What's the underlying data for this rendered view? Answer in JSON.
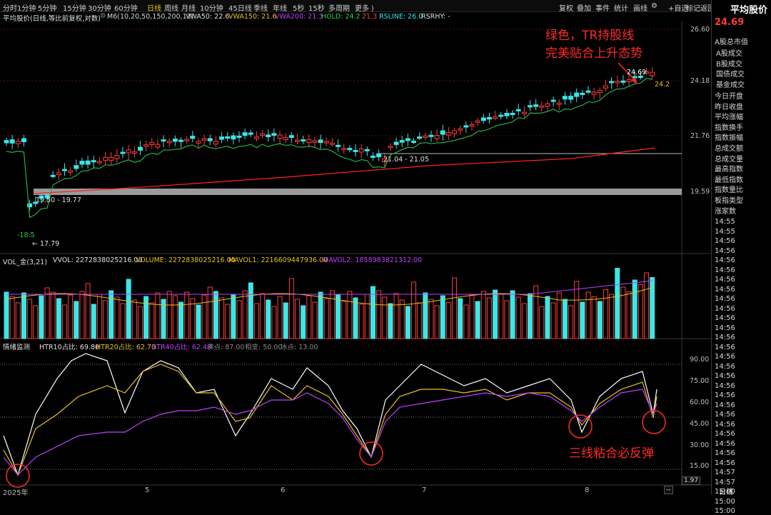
{
  "toolbar": {
    "periods": [
      "分时",
      "1分钟",
      "5分钟",
      "15分钟",
      "30分钟",
      "60分钟",
      "日线",
      "周线",
      "月线",
      "10分钟",
      "45日线",
      "季线",
      "年线",
      "5秒",
      "15秒",
      "多周期",
      "更多 ⟩"
    ],
    "active_period": "日线",
    "right_buttons": [
      "复权",
      "叠加",
      "事件",
      "统计",
      "画线",
      "⚙",
      "+自选",
      "标记",
      "返回"
    ]
  },
  "main_indicator": {
    "title": "平均股价(日线,等比前复权,对数)",
    "m6": "M6(10,20,50,150,200,13)",
    "vwa50": "VWA50: 22.6",
    "vwa150": "VWA150: 21.6",
    "vwa200": "VWA200: 21.3",
    "hold": "HOLD: 24.2",
    "hold_sub": "21.3",
    "rsline": "RSLINE: 26.0",
    "rsrhy": "RSRHY: -"
  },
  "main_axis": [
    "26.60",
    "24.18",
    "21.76",
    "19.59"
  ],
  "main_labels": {
    "hi_price": "24.69",
    "last_price": "24.2",
    "band_label": "21.04 - 21.05",
    "support_label": "19.50 - 19.77",
    "low_label": "-18.5",
    "min_label": "17.79"
  },
  "vol_indicator": {
    "title": "VOL_金(3,21)",
    "vvol": "VVOL: 2272838025216.00",
    "volume": "VOLUME: 2272838025216.00",
    "mavol1": "MAVOL1: 2216609447936.00",
    "mavol2": "MAVOL2: 1858983821312.00"
  },
  "sent_indicator": {
    "title": "情绪监测",
    "htr10": "HTR10占比: 69.80",
    "htr20": "HTR20占比: 62.70",
    "htr40": "HTR40占比: 62.48",
    "boil": "沸点: 87.00",
    "phase": "相变: 50.00",
    "ice": "冰点: 13.00"
  },
  "sent_axis": [
    "90.00",
    "75.00",
    "60.00",
    "45.00",
    "30.00",
    "15.00"
  ],
  "x_axis": [
    "2025年",
    "5",
    "6",
    "7",
    "8"
  ],
  "annotations": {
    "top_line1": "绿色，TR持股线",
    "top_line2": "完美贴合上升态势",
    "bottom": "三线粘合必反弹"
  },
  "right_panel": {
    "title": "平均股价",
    "price": "24.69",
    "items": [
      "A股总市值",
      "A股成交",
      "B股成交",
      "国债成交",
      "基金成交",
      "今日开盘",
      "昨日收盘",
      "平均涨幅",
      "指数换手",
      "指数振幅",
      "总成交额",
      "总成交量",
      "最高指数",
      "最低指数",
      "指数量比",
      "板指类型",
      "涨家数"
    ],
    "times": [
      "14:55",
      "14:55",
      "14:56",
      "14:56",
      "14:56",
      "14:56",
      "14:56",
      "14:56",
      "14:56",
      "14:56",
      "14:56",
      "14:56",
      "14:56",
      "14:56",
      "14:56",
      "14:56",
      "14:56",
      "14:56",
      "14:56",
      "14:56",
      "14:56",
      "14:56",
      "14:56",
      "14:56",
      "14:56",
      "14:56",
      "14:57",
      "14:57",
      "15:00",
      "15:00",
      "15:00"
    ],
    "bottom_tab": "日线",
    "bottom_value": "1.97"
  },
  "colors": {
    "up": "#ff3b3b",
    "down": "#3ce6e6",
    "tr_line": "#22b14c",
    "ma_red": "#ff2020",
    "white": "#ffffff",
    "yellow": "#e8c21c",
    "purple": "#c040ff",
    "gray_band": "#9a9a9a"
  }
}
